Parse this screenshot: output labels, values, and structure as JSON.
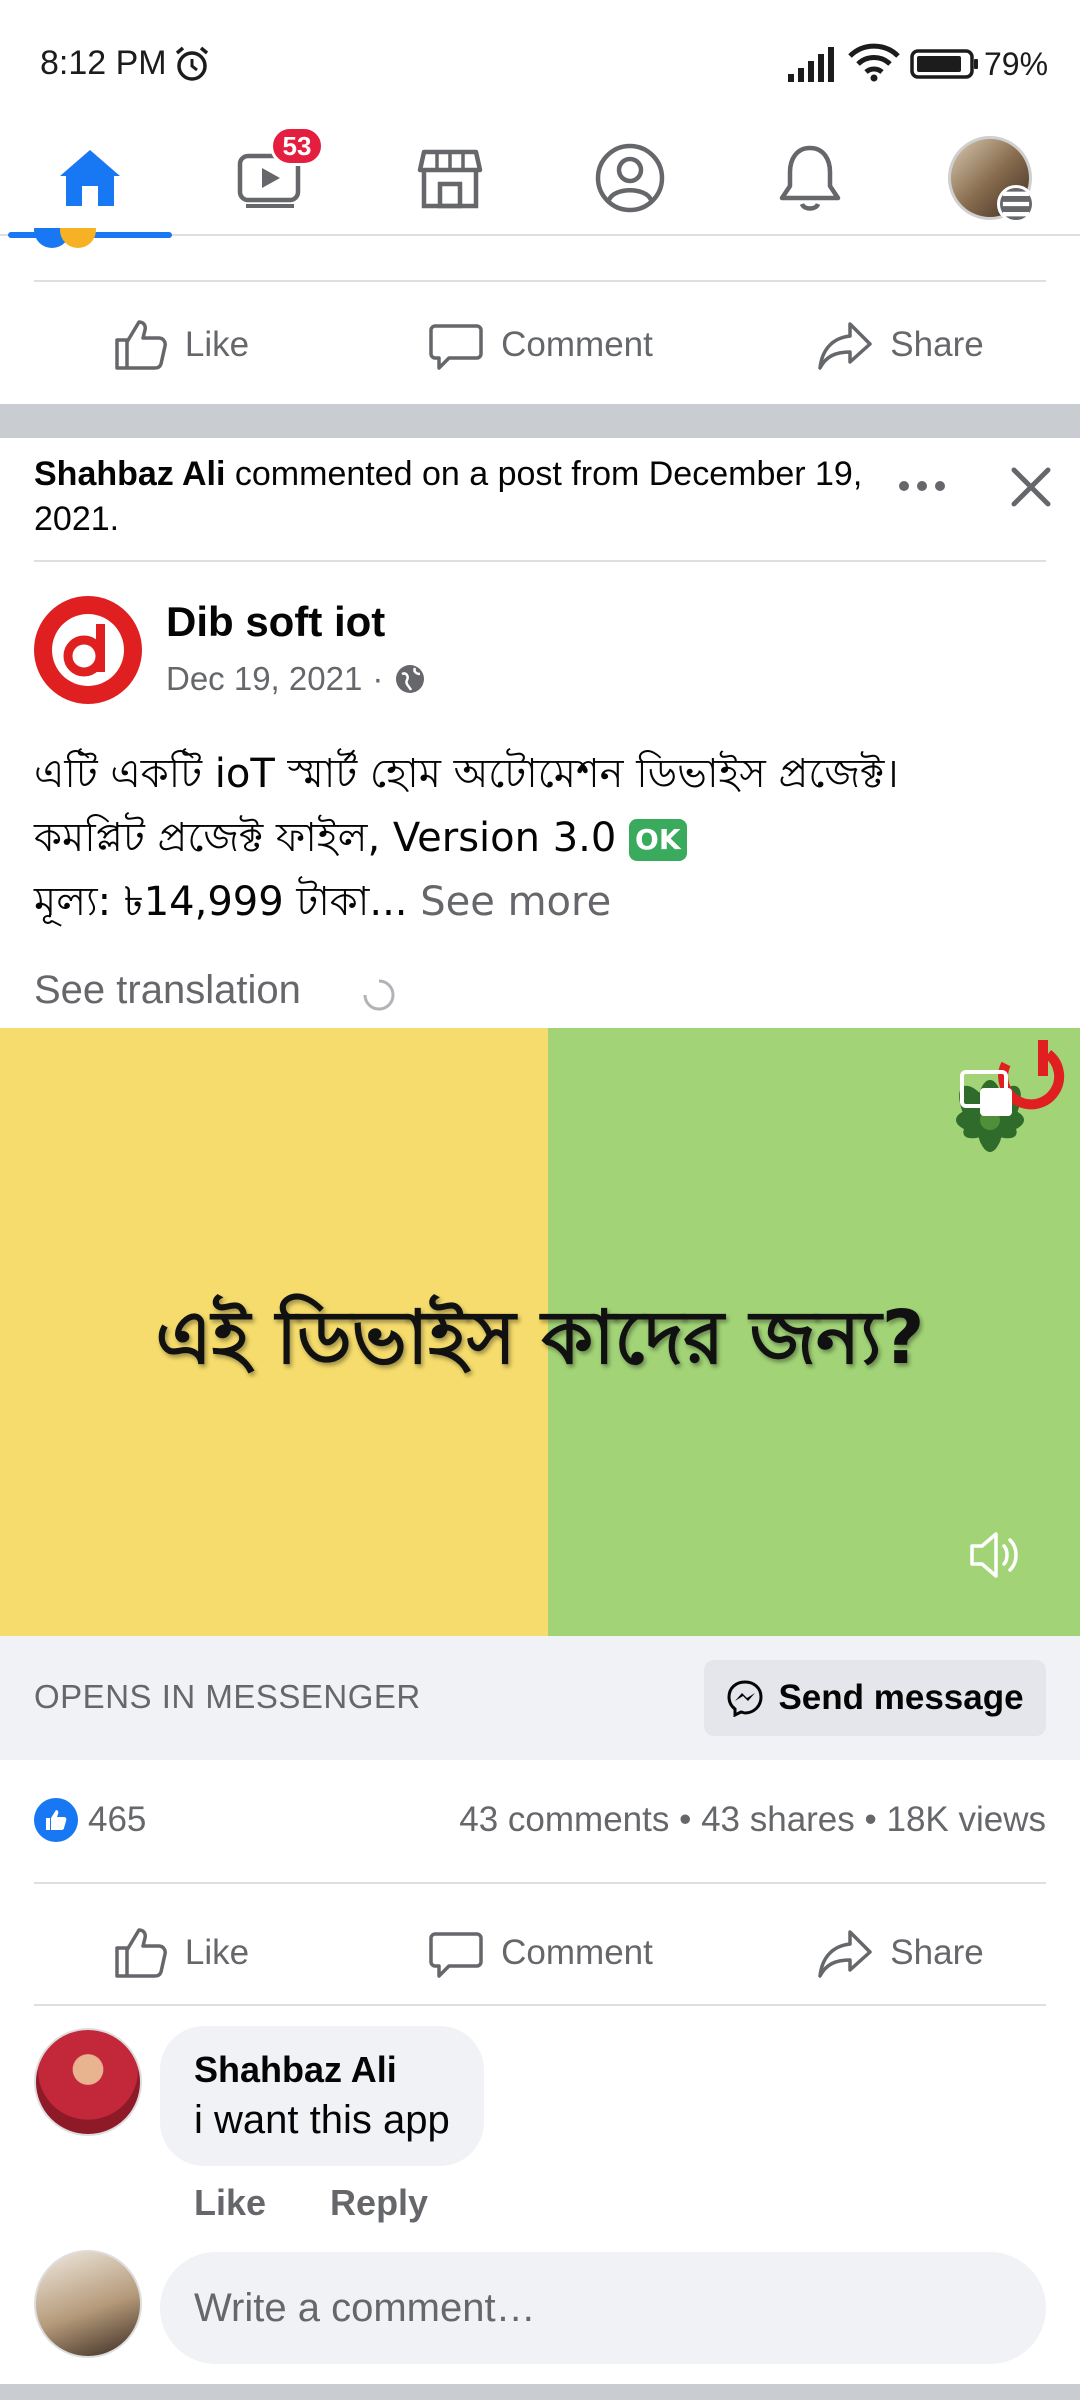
{
  "status_bar": {
    "time": "8:12 PM",
    "battery": "79%"
  },
  "nav": {
    "items": [
      "home-icon",
      "video-icon",
      "marketplace-icon",
      "profile-icon",
      "bell-icon",
      "menu-avatar"
    ],
    "active": "home",
    "video_badge": "53",
    "accent_color": "#1877f2",
    "badge_color": "#e41e3f"
  },
  "actions": {
    "like": "Like",
    "comment": "Comment",
    "share": "Share"
  },
  "story": {
    "actor": "Shahbaz Ali",
    "text": " commented on a post from December 19, 2021."
  },
  "post": {
    "page_name": "Dib soft iot",
    "date": "Dec 19, 2021",
    "meta_separator": "·",
    "line1": "এটি একটি ioT স্মার্ট হোম অটোমেশন ডিভাইস প্রজেক্ট।",
    "line2": "কমপ্লিট প্রজেক্ট ফাইল, Version 3.0",
    "ok_emoji": "OK",
    "line3": "মূল্য: ৳14,999 টাকা...",
    "see_more": " See more",
    "see_translation": "See translation"
  },
  "video": {
    "title": "এই ডিভাইস কাদের জন্য?",
    "left_color": "#f5dc6c",
    "right_color": "#a2d477"
  },
  "cta": {
    "label": "OPENS IN MESSENGER",
    "button": "Send message"
  },
  "engagement": {
    "likes": "465",
    "summary": "43 comments • 43 shares • 18K views"
  },
  "comment": {
    "author": "Shahbaz Ali",
    "text": "i want this app",
    "like": "Like",
    "reply": "Reply"
  },
  "composer": {
    "placeholder": "Write a comment…"
  }
}
